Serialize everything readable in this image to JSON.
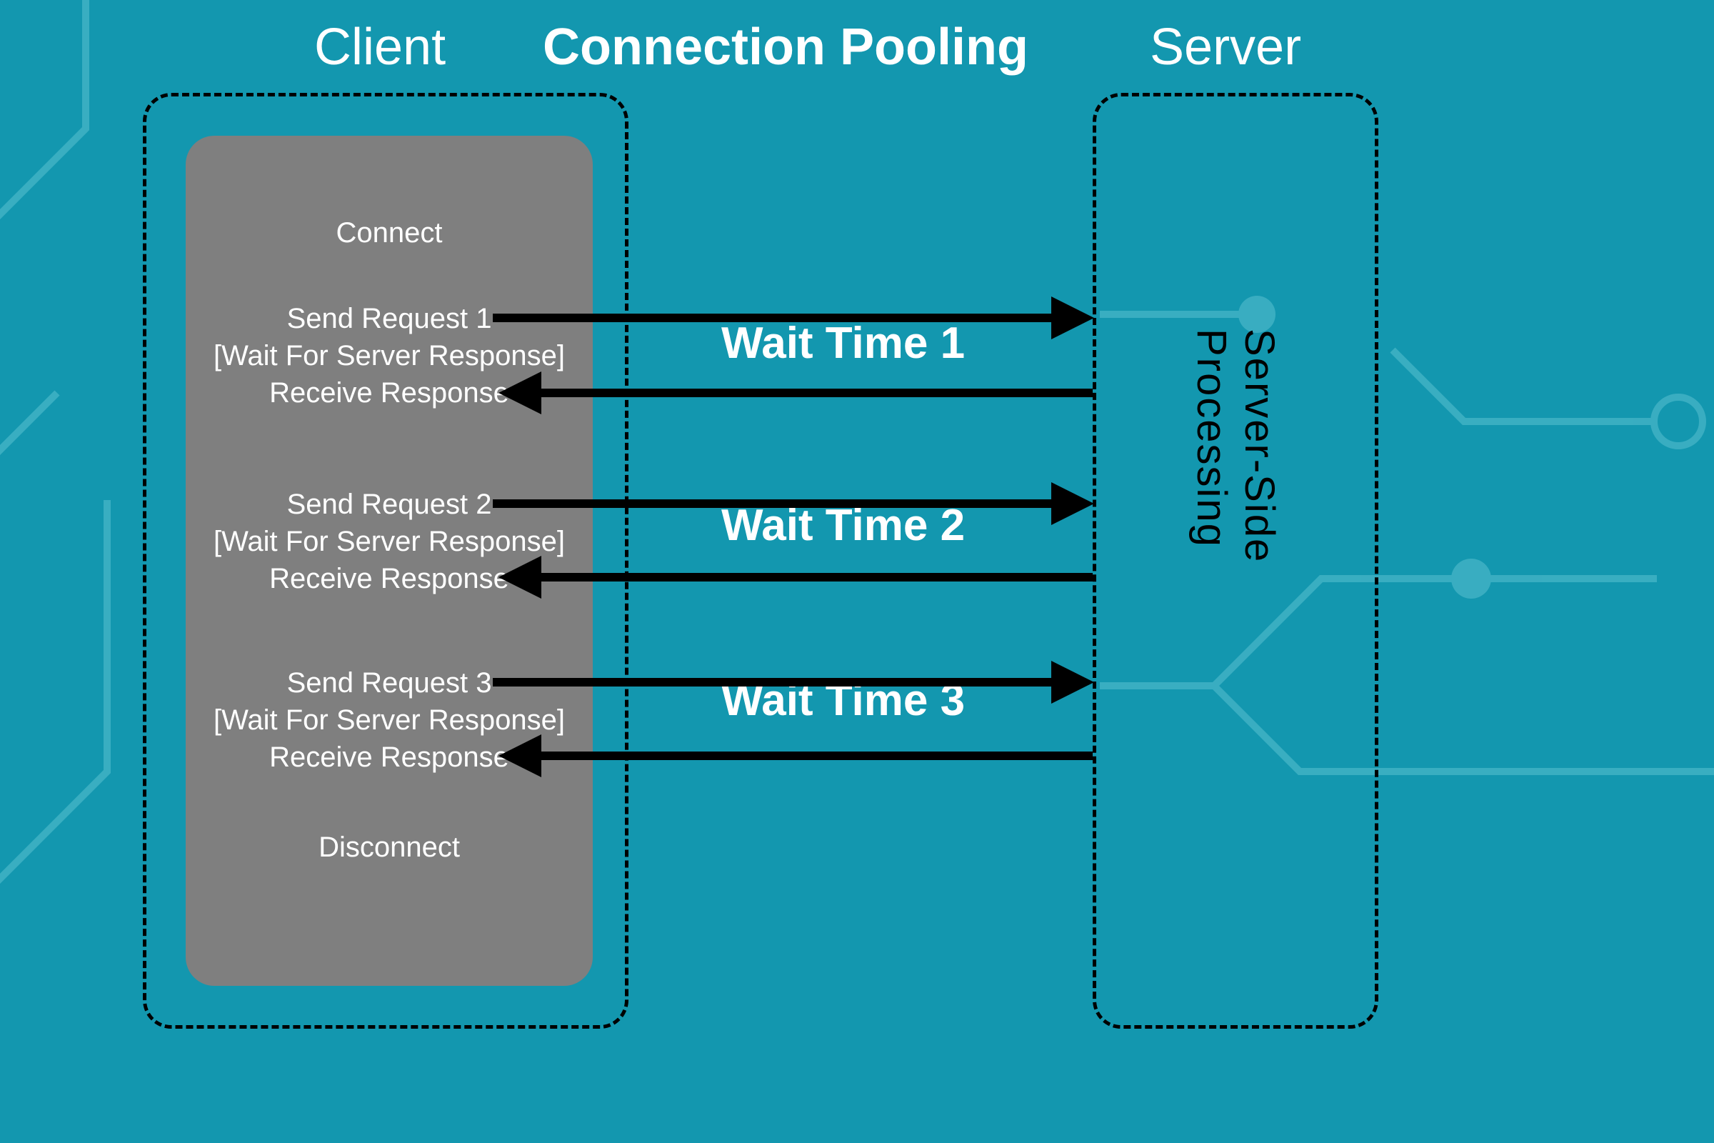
{
  "header": {
    "client_label": "Client",
    "title": "Connection Pooling",
    "server_label": "Server"
  },
  "client_panel": {
    "connect": "Connect",
    "disconnect": "Disconnect",
    "groups": [
      {
        "send": "Send Request 1",
        "wait": "[Wait For Server Response]",
        "recv": "Receive Response"
      },
      {
        "send": "Send Request 2",
        "wait": "[Wait For Server Response]",
        "recv": "Receive Response"
      },
      {
        "send": "Send Request 3",
        "wait": "[Wait For Server Response]",
        "recv": "Receive Response"
      }
    ]
  },
  "server_panel": {
    "label": "Server-Side Processing"
  },
  "wait_labels": [
    "Wait Time 1",
    "Wait Time 2",
    "Wait Time 3"
  ]
}
